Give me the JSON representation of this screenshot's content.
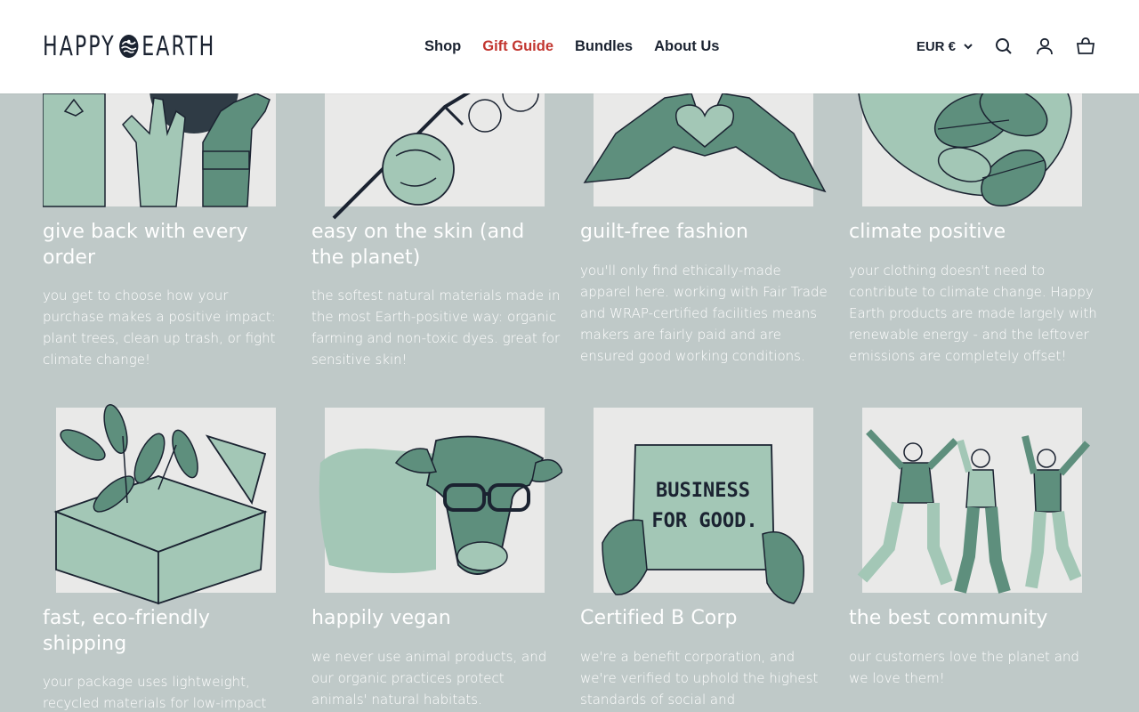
{
  "header": {
    "logo_left": "HAPPY",
    "logo_right": "EARTH",
    "nav": [
      {
        "label": "Shop",
        "active": false
      },
      {
        "label": "Gift Guide",
        "active": true
      },
      {
        "label": "Bundles",
        "active": false
      },
      {
        "label": "About Us",
        "active": false
      }
    ],
    "currency": "EUR €"
  },
  "features": [
    {
      "title": "give back with every order",
      "text": "you get to choose how your purchase makes a positive impact: plant trees, clean up trash, or fight climate change!"
    },
    {
      "title": "easy on the skin (and the planet)",
      "text": "the softest natural materials made in the most Earth-positive way: organic farming and non-toxic dyes. great for sensitive skin!"
    },
    {
      "title": "guilt-free fashion",
      "text": "you'll only find ethically-made apparel here. working with Fair Trade and WRAP-certified facilities means makers are fairly paid and are ensured good working conditions."
    },
    {
      "title": "climate positive",
      "text": "your clothing doesn't need to contribute to climate change. Happy Earth products are made largely with renewable energy - and the leftover emissions are completely offset!"
    },
    {
      "title": "fast, eco-friendly shipping",
      "text": "your package uses lightweight, recycled materials for low-impact"
    },
    {
      "title": "happily vegan",
      "text": "we never use animal products, and our organic practices protect animals' natural habitats."
    },
    {
      "title": "Certified B Corp",
      "text": "we're a benefit corporation, and we're verified to uphold the highest standards of social and"
    },
    {
      "title": "the best community",
      "text": "our customers love the planet and we love them!"
    }
  ],
  "sign_text": {
    "line1": "BUSINESS",
    "line2": "FOR GOOD."
  },
  "colors": {
    "accent": "#c2352f",
    "illustration_green": "#5e8f7d",
    "illustration_light": "#a3c7b6",
    "background": "#bfc9c8",
    "ink": "#1b2331"
  }
}
